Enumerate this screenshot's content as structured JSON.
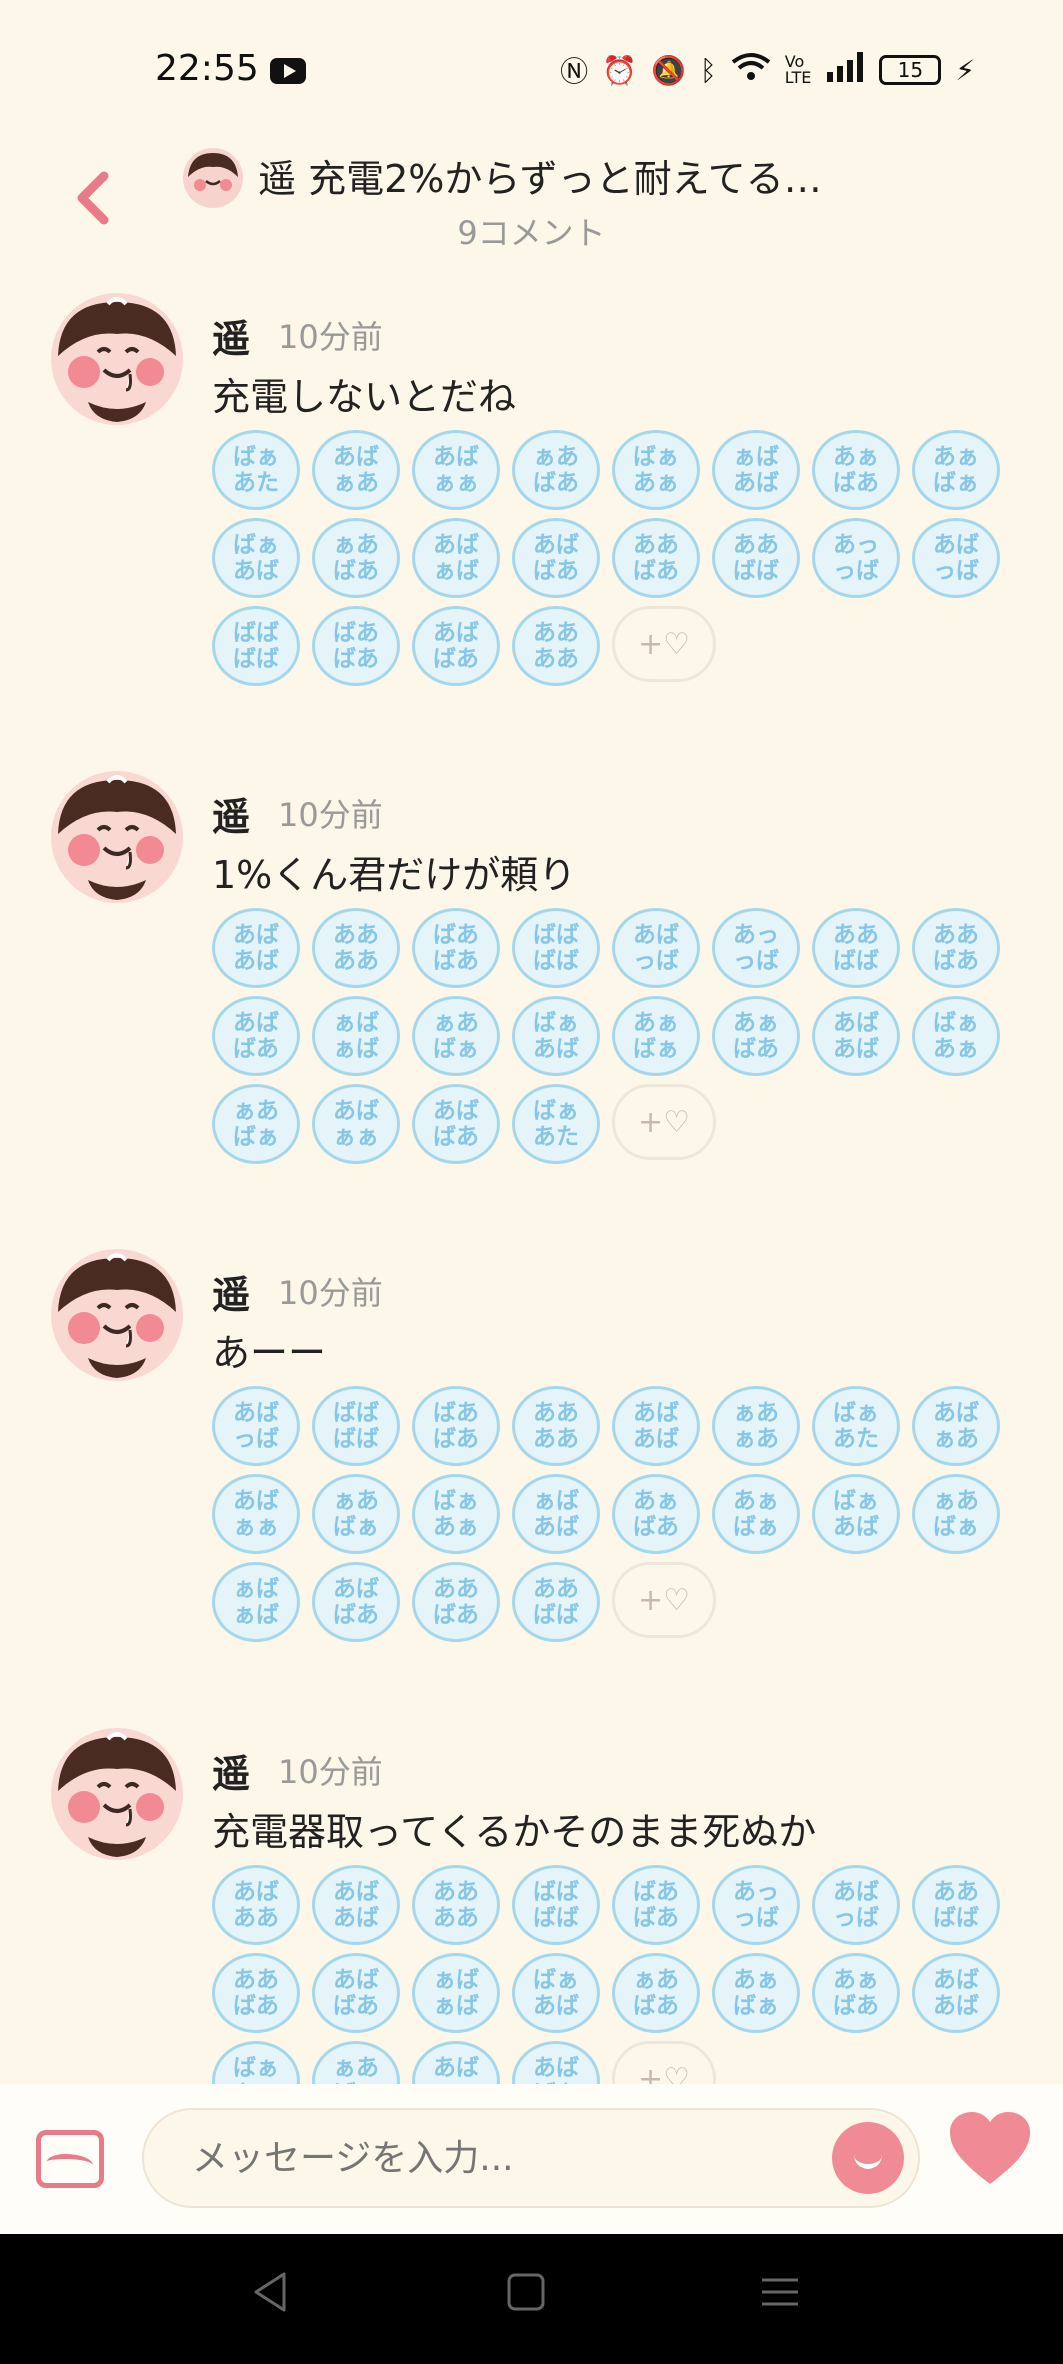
{
  "status": {
    "time": "22:55",
    "battery": "15"
  },
  "header": {
    "title": "遥 充電2%からずっと耐えてる…",
    "subtitle": "9コメント"
  },
  "comments": [
    {
      "name": "遥",
      "time": "10分前",
      "text": "充電しないとだね",
      "stamps": [
        "ばぁ\nあた",
        "あば\nぁあ",
        "あば\nぁぁ",
        "ぁあ\nばあ",
        "ばぁ\nあぁ",
        "ぁば\nあば",
        "あぁ\nばあ",
        "あぁ\nばぁ",
        "ばぁ\nあば",
        "ぁあ\nばあ",
        "あば\nぁば",
        "あば\nばあ",
        "ああ\nばあ",
        "ああ\nばば",
        "あっ\nっば",
        "あば\nっば",
        "ばば\nばば",
        "ばあ\nばあ",
        "あば\nばあ",
        "ああ\nああ"
      ],
      "add": "+♡"
    },
    {
      "name": "遥",
      "time": "10分前",
      "text": "1%くん君だけが頼り",
      "stamps": [
        "あば\nあば",
        "ああ\nああ",
        "ばあ\nばあ",
        "ばば\nばば",
        "あば\nっば",
        "あっ\nっば",
        "ああ\nばば",
        "ああ\nばあ",
        "あば\nばあ",
        "ぁば\nぁば",
        "ぁあ\nばぁ",
        "ばぁ\nあば",
        "あぁ\nばぁ",
        "あぁ\nばあ",
        "あば\nあば",
        "ばぁ\nあぁ",
        "ぁあ\nばぁ",
        "あば\nぁぁ",
        "あば\nばあ",
        "ばぁ\nあた"
      ],
      "add": "+♡"
    },
    {
      "name": "遥",
      "time": "10分前",
      "text": "あーー",
      "stamps": [
        "あば\nっば",
        "ばば\nばば",
        "ばあ\nばあ",
        "ああ\nああ",
        "あば\nあば",
        "ぁあ\nぁあ",
        "ばぁ\nあた",
        "あば\nぁあ",
        "あば\nぁぁ",
        "ぁあ\nばぁ",
        "ばぁ\nあぁ",
        "ぁば\nあば",
        "あぁ\nばあ",
        "あぁ\nばぁ",
        "ばぁ\nあば",
        "ぁあ\nばぁ",
        "ぁば\nぁば",
        "あば\nばあ",
        "ああ\nばあ",
        "ああ\nばば"
      ],
      "add": "+♡"
    },
    {
      "name": "遥",
      "time": "10分前",
      "text": "充電器取ってくるかそのまま死ぬか",
      "stamps": [
        "あば\nああ",
        "あば\nあば",
        "ああ\nああ",
        "ばば\nばば",
        "ばあ\nばあ",
        "あっ\nっば",
        "あば\nっば",
        "ああ\nばば",
        "ああ\nばあ",
        "あば\nばあ",
        "ぁば\nぁば",
        "ばぁ\nあば",
        "ぁあ\nばあ",
        "あぁ\nばぁ",
        "あぁ\nばあ",
        "あば\nあば",
        "ばぁ\nあぁ",
        "ぁあ\nばぁ",
        "あば\nぁぁ",
        "あば\nばあ"
      ],
      "add": "+♡"
    }
  ],
  "input": {
    "placeholder": "メッセージを入力..."
  },
  "colors": {
    "accent": "#e87a8a",
    "stamp_border": "#a5d7ec",
    "background": "#fdf7ea"
  }
}
